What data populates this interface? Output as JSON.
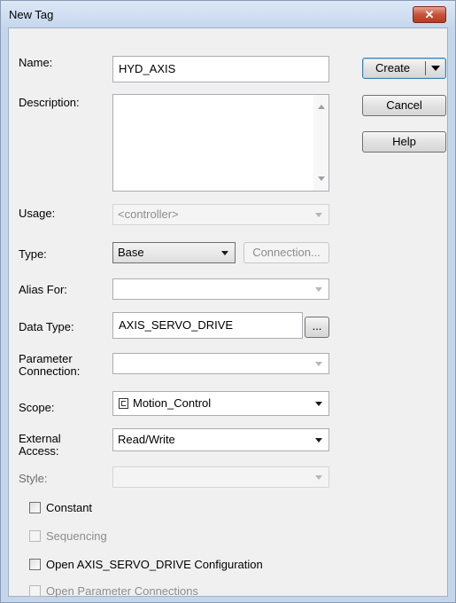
{
  "window": {
    "title": "New Tag",
    "close_glyph": "✕"
  },
  "labels": {
    "name": "Name:",
    "description": "Description:",
    "usage": "Usage:",
    "type": "Type:",
    "alias_for": "Alias For:",
    "data_type": "Data Type:",
    "parameter_connection_1": "Parameter",
    "parameter_connection_2": "Connection:",
    "scope": "Scope:",
    "external_access_1": "External",
    "external_access_2": "Access:",
    "style": "Style:"
  },
  "fields": {
    "name": "HYD_AXIS",
    "description": "",
    "usage": "<controller>",
    "type": "Base",
    "alias_for": "",
    "data_type": "AXIS_SERVO_DRIVE",
    "parameter_connection": "",
    "scope": "Motion_Control",
    "external_access": "Read/Write",
    "style": ""
  },
  "buttons": {
    "create": "Create",
    "cancel": "Cancel",
    "help": "Help",
    "connection": "Connection...",
    "browse_data_type": "..."
  },
  "checkboxes": [
    {
      "label": "Constant",
      "checked": false,
      "enabled": true
    },
    {
      "label": "Sequencing",
      "checked": false,
      "enabled": false
    },
    {
      "label": "Open AXIS_SERVO_DRIVE Configuration",
      "checked": false,
      "enabled": true
    },
    {
      "label": "Open Parameter Connections",
      "checked": false,
      "enabled": false
    }
  ],
  "icons": {
    "scope_icon": "program-icon",
    "dropdown": "chevron-down-icon"
  },
  "colors": {
    "title_bar": "#c6d7ed",
    "close_button": "#c8523c",
    "dialog_bg": "#f0f0f0"
  }
}
